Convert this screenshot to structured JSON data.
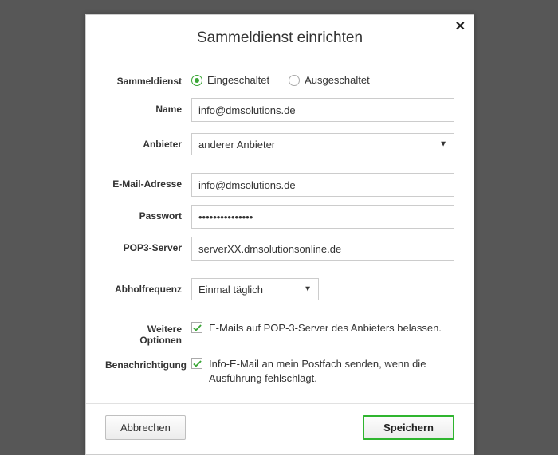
{
  "dialog": {
    "title": "Sammeldienst einrichten",
    "close_title": "Schließen"
  },
  "labels": {
    "sammeldienst": "Sammeldienst",
    "name": "Name",
    "anbieter": "Anbieter",
    "email": "E-Mail-Adresse",
    "passwort": "Passwort",
    "pop3": "POP3-Server",
    "abholfrequenz": "Abholfrequenz",
    "weitere": "Weitere Optionen",
    "benachrichtigung": "Benachrichtigung"
  },
  "radios": {
    "on": "Eingeschaltet",
    "off": "Ausgeschaltet"
  },
  "fields": {
    "name": "info@dmsolutions.de",
    "anbieter": "anderer Anbieter",
    "email": "info@dmsolutions.de",
    "passwort": "•••••••••••••••",
    "pop3": "serverXX.dmsolutionsonline.de",
    "abholfrequenz": "Einmal täglich"
  },
  "checkboxes": {
    "keep_mails": "E-Mails auf POP-3-Server des Anbieters belassen.",
    "notify_fail": "Info-E-Mail an mein Postfach senden, wenn die Ausführung fehlschlägt."
  },
  "buttons": {
    "cancel": "Abbrechen",
    "save": "Speichern"
  }
}
